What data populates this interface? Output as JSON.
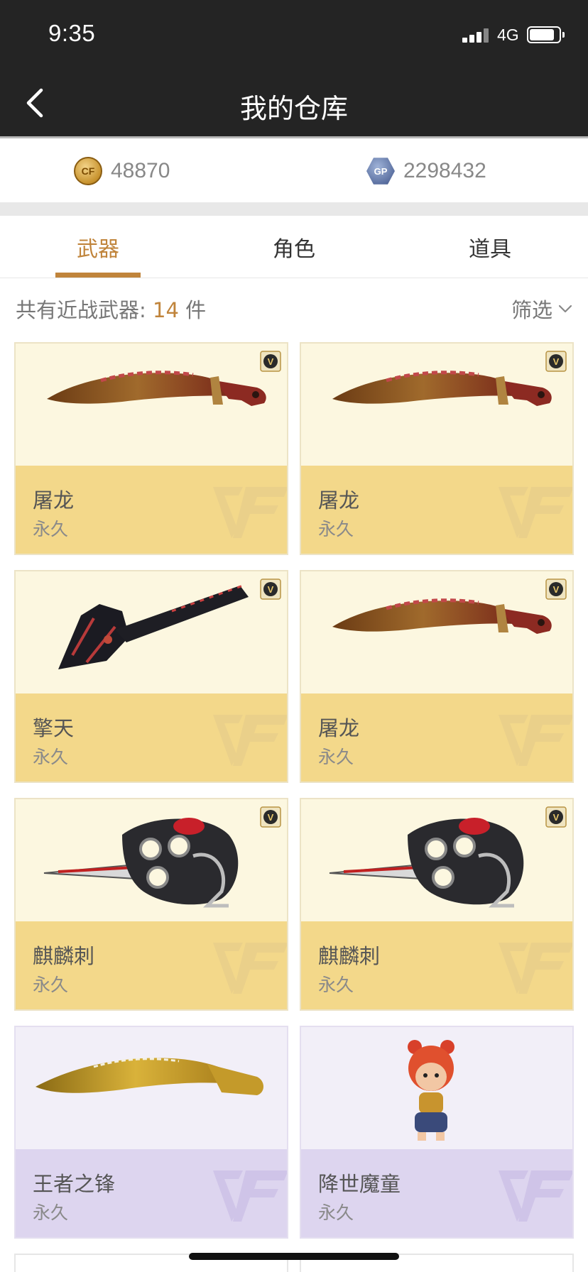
{
  "status_bar": {
    "time": "9:35",
    "network": "4G",
    "battery_level": 0.85
  },
  "nav": {
    "title": "我的仓库",
    "back_icon": "chevron-left-icon"
  },
  "currency": {
    "cf_points": {
      "icon": "cf-coin-icon",
      "value": "48870"
    },
    "gp": {
      "icon": "gp-coin-icon",
      "icon_text": "GP",
      "value": "2298432"
    }
  },
  "tabs": [
    {
      "label": "武器",
      "active": true
    },
    {
      "label": "角色",
      "active": false
    },
    {
      "label": "道具",
      "active": false
    }
  ],
  "summary": {
    "prefix": "共有近战武器: ",
    "count": "14",
    "suffix": " 件",
    "filter_label": "筛选"
  },
  "colors": {
    "accent": "#c0843b",
    "gold_card_top": "#fcf7e0",
    "gold_card_bottom": "#f3d88a",
    "purple_card_top": "#f2eff8",
    "purple_card_bottom": "#ddd5ef",
    "header_bg": "#242424"
  },
  "items": [
    {
      "name": "屠龙",
      "duration": "永久",
      "art": "dragon-knife",
      "vip": true,
      "tier": "gold"
    },
    {
      "name": "屠龙",
      "duration": "永久",
      "art": "dragon-knife",
      "vip": true,
      "tier": "gold"
    },
    {
      "name": "擎天",
      "duration": "永久",
      "art": "shovel",
      "vip": true,
      "tier": "gold"
    },
    {
      "name": "屠龙",
      "duration": "永久",
      "art": "dragon-knife",
      "vip": true,
      "tier": "gold"
    },
    {
      "name": "麒麟刺",
      "duration": "永久",
      "art": "qilin-knuckle",
      "vip": true,
      "tier": "gold"
    },
    {
      "name": "麒麟刺",
      "duration": "永久",
      "art": "qilin-knuckle",
      "vip": true,
      "tier": "gold"
    },
    {
      "name": "王者之锋",
      "duration": "永久",
      "art": "golden-kukri",
      "vip": false,
      "tier": "purple"
    },
    {
      "name": "降世魔童",
      "duration": "永久",
      "art": "nezha-figure",
      "vip": false,
      "tier": "purple"
    }
  ]
}
